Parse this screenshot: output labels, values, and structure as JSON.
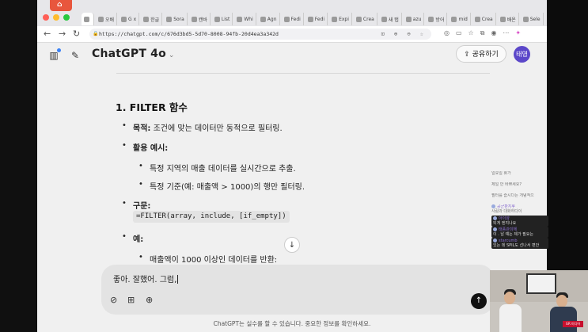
{
  "browser": {
    "tabs": [
      "",
      "오배",
      "G x",
      "한글",
      "Sora",
      "캔바",
      "List",
      "Whi",
      "Agn",
      "Fedi",
      "Fedi",
      "Expi",
      "Crea",
      "새 탭",
      "azu",
      "방어",
      "mid",
      "Crea",
      "배온",
      "Sele"
    ],
    "active_tab_index": 0,
    "url": "https://chatgpt.com/c/676d3bd5-5d70-8008-94fb-20d4ea3a342d",
    "accent_logo_color": "#e8563d"
  },
  "app": {
    "model_name": "ChatGPT 4o",
    "share_label": "공유하기",
    "avatar_initials": "태영",
    "avatar_color": "#5b47c9"
  },
  "content": {
    "heading": "1. FILTER 함수",
    "purpose_label": "목적:",
    "purpose_text": " 조건에 맞는 데이터만 동적으로 필터링.",
    "usage_label": "활용 예시:",
    "usage_1": "특정 지역의 매출 데이터를 실시간으로 추출.",
    "usage_2": "특정 기준(예: 매출액 > 1000)의 행만 필터링.",
    "syntax_label": "구문:",
    "syntax_code": "=FILTER(array, include, [if_empty])",
    "example_label": "예:",
    "example_1": "매출액이 1000 이상인 데이터를 반환:"
  },
  "composer": {
    "text": "좋아. 잘했어. 그럼,",
    "disclaimer": "ChatGPT는 실수를 할 수 있습니다. 중요한 정보를 확인하세요."
  },
  "overlay_chat": [
    {
      "name": "",
      "text": "일요일 휴가"
    },
    {
      "name": "",
      "text": "제일 안 바쁘세요?"
    },
    {
      "name": "",
      "text": "필터를 줍시다는 개념적으"
    },
    {
      "name": "공군판지후",
      "text": "사람과 대화하다이"
    },
    {
      "name": "아이얌",
      "text": "되게 엔지나요"
    },
    {
      "name": "태풍관미해",
      "text": "이 . 남 얘는 제가 필요는"
    },
    {
      "name": "starcumb",
      "text": "있는 데 SPIL도 선나서 편안"
    }
  ],
  "webcam": {
    "logo_text": "GR 미디어"
  }
}
